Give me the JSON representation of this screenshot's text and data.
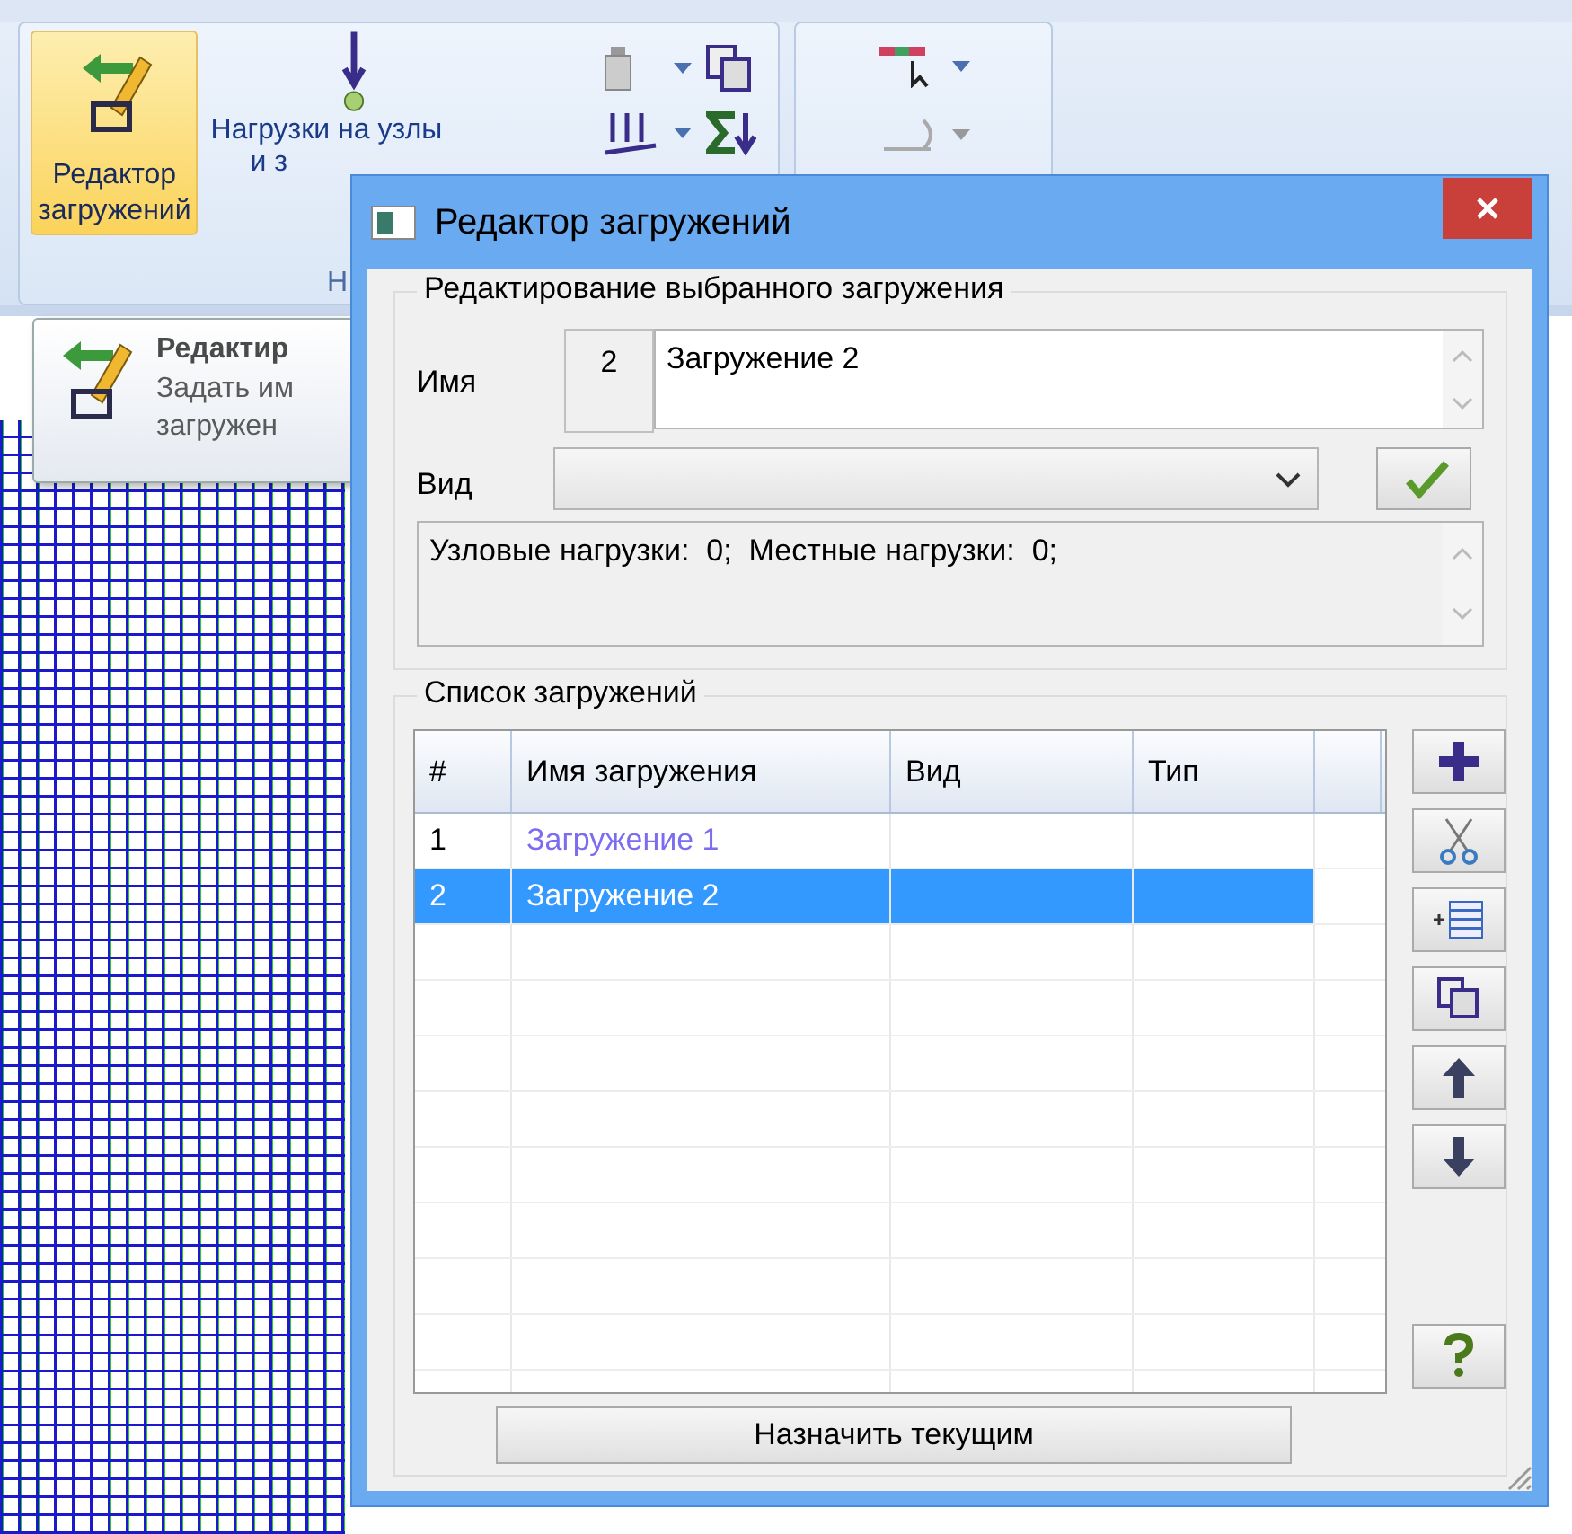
{
  "ribbon": {
    "buttons": [
      {
        "kind": "editor",
        "label_lines": [
          "Редактор",
          "загружений"
        ],
        "selected": true
      },
      {
        "kind": "node-load",
        "label_lines": [
          "Нагрузки на узлы",
          "и з"
        ],
        "selected": false
      }
    ],
    "group_label": "Н"
  },
  "tooltip": {
    "title": "Редактир",
    "description_lines": [
      "Задать им",
      "загружен"
    ]
  },
  "dialog": {
    "title": "Редактор загружений",
    "edit_group": {
      "legend": "Редактирование выбранного загружения",
      "name_label": "Имя",
      "index": "2",
      "name_value": "Загружение 2",
      "kind_label": "Вид",
      "info": "Узловые нагрузки:  0;  Местные нагрузки:  0;"
    },
    "list_group": {
      "legend": "Список загружений",
      "columns": [
        "#",
        "Имя загружения",
        "Вид",
        "Тип"
      ],
      "rows": [
        {
          "number": "1",
          "name": "Загружение 1",
          "current": true,
          "selected": false
        },
        {
          "number": "2",
          "name": "Загружение 2",
          "current": false,
          "selected": true
        }
      ],
      "side_buttons": [
        {
          "kind": "add"
        },
        {
          "kind": "cut"
        },
        {
          "kind": "insert"
        },
        {
          "kind": "copy"
        },
        {
          "kind": "up"
        },
        {
          "kind": "down"
        },
        {
          "kind": "help"
        }
      ],
      "assign_button": "Назначить текущим"
    }
  }
}
